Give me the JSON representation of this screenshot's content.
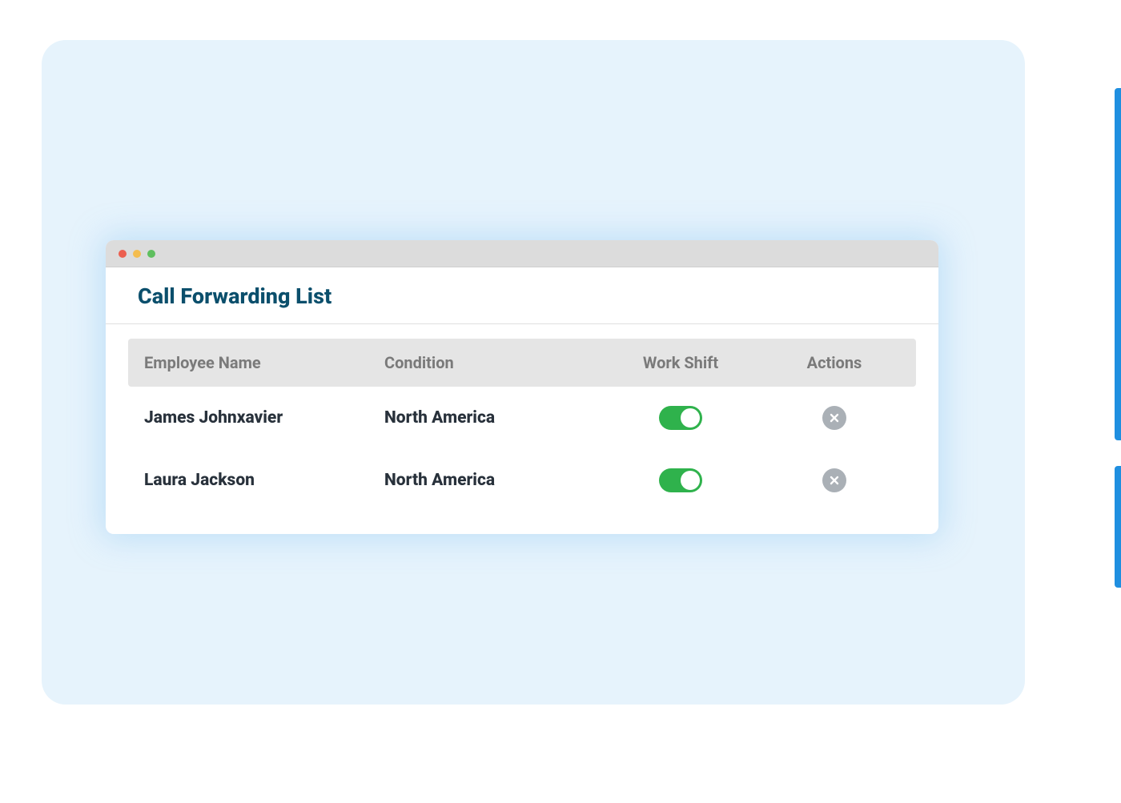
{
  "panel": {
    "title": "Call Forwarding List",
    "columns": {
      "employee": "Employee Name",
      "condition": "Condition",
      "shift": "Work Shift",
      "actions": "Actions"
    },
    "rows": [
      {
        "name": "James Johnxavier",
        "condition": "North America",
        "shift_on": true
      },
      {
        "name": "Laura Jackson",
        "condition": "North America",
        "shift_on": true
      }
    ]
  },
  "colors": {
    "toggle_on": "#2fb24c",
    "delete_btn": "#aab0b6",
    "title": "#0b4f6c"
  }
}
